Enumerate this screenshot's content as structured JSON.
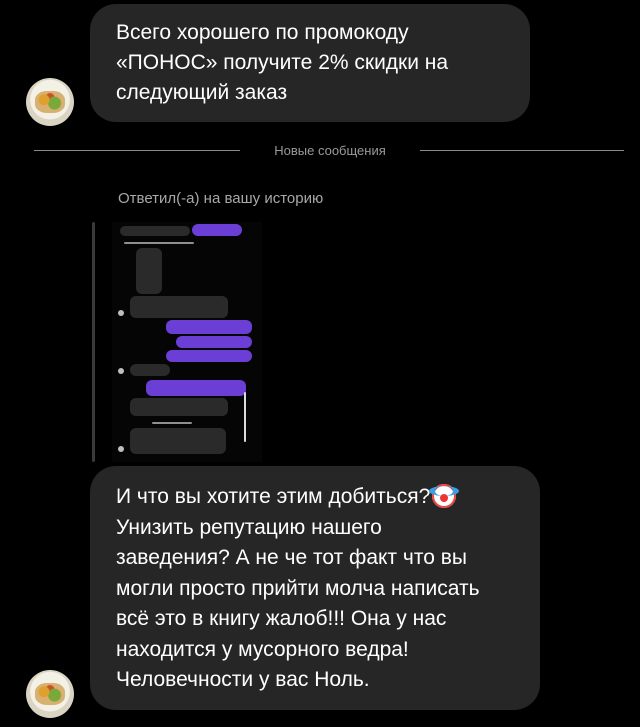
{
  "messages": {
    "top": {
      "lines": [
        "Всего хорошего по промокоду",
        "«ПОНОС» получите 2% скидки на",
        "следующий заказ"
      ]
    },
    "divider_label": "Новые сообщения",
    "reply_label": "Ответил(-а) на вашу историю",
    "bottom": {
      "line1": "И что вы хотите этим добиться?",
      "lines": [
        "Унизить репутацию нашего",
        "заведения? А не че тот факт что вы",
        "могли просто прийти молча написать",
        "всё это в книгу жалоб!!! Она у нас",
        "находится у мусорного ведра!",
        "Человечности у вас Ноль."
      ],
      "emoji": "clown-face-icon"
    }
  },
  "colors": {
    "background": "#000000",
    "bubble": "#262626",
    "story_accent": "#6b3fd6"
  }
}
